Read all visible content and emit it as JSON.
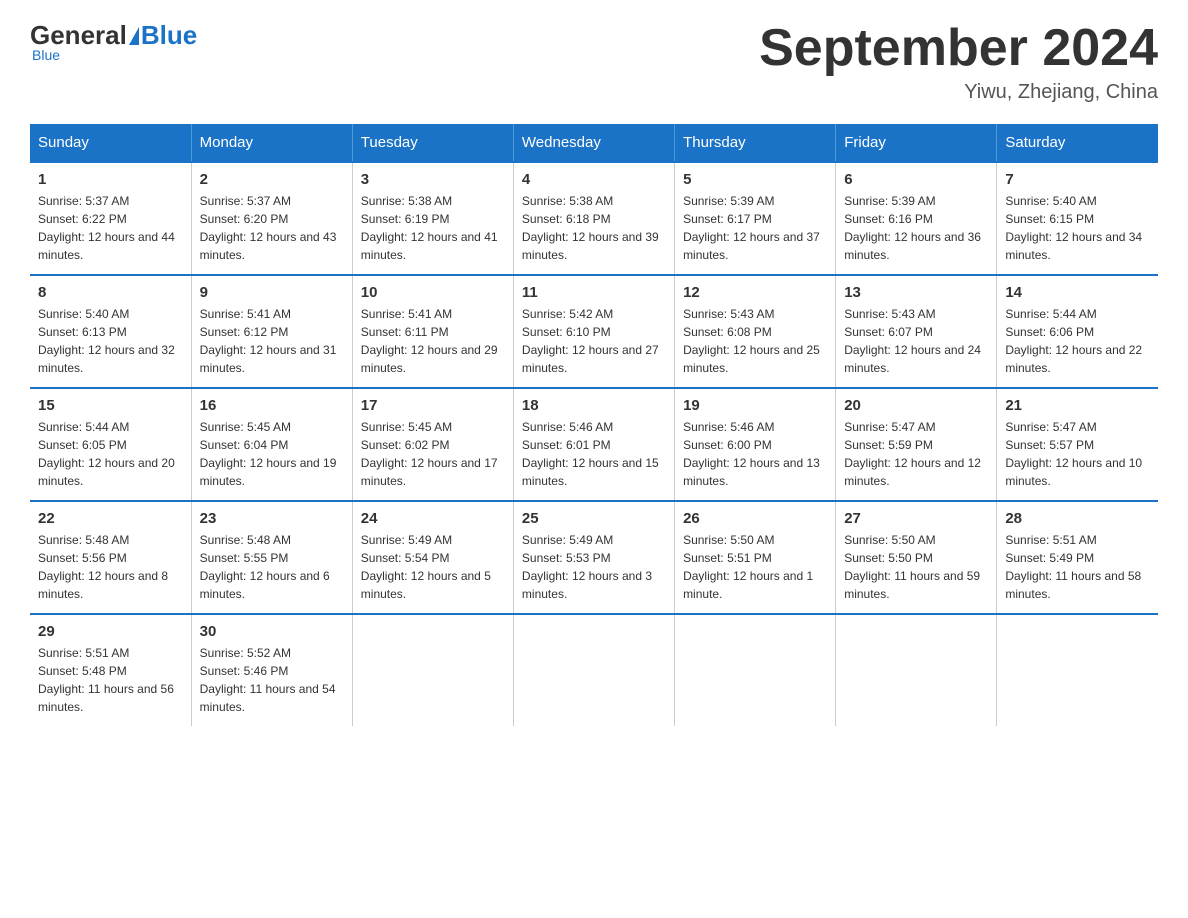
{
  "logo": {
    "general": "General",
    "blue": "Blue",
    "sub": "Blue"
  },
  "header": {
    "month_title": "September 2024",
    "subtitle": "Yiwu, Zhejiang, China"
  },
  "weekdays": [
    "Sunday",
    "Monday",
    "Tuesday",
    "Wednesday",
    "Thursday",
    "Friday",
    "Saturday"
  ],
  "weeks": [
    [
      {
        "day": "1",
        "sunrise": "5:37 AM",
        "sunset": "6:22 PM",
        "daylight": "12 hours and 44 minutes."
      },
      {
        "day": "2",
        "sunrise": "5:37 AM",
        "sunset": "6:20 PM",
        "daylight": "12 hours and 43 minutes."
      },
      {
        "day": "3",
        "sunrise": "5:38 AM",
        "sunset": "6:19 PM",
        "daylight": "12 hours and 41 minutes."
      },
      {
        "day": "4",
        "sunrise": "5:38 AM",
        "sunset": "6:18 PM",
        "daylight": "12 hours and 39 minutes."
      },
      {
        "day": "5",
        "sunrise": "5:39 AM",
        "sunset": "6:17 PM",
        "daylight": "12 hours and 37 minutes."
      },
      {
        "day": "6",
        "sunrise": "5:39 AM",
        "sunset": "6:16 PM",
        "daylight": "12 hours and 36 minutes."
      },
      {
        "day": "7",
        "sunrise": "5:40 AM",
        "sunset": "6:15 PM",
        "daylight": "12 hours and 34 minutes."
      }
    ],
    [
      {
        "day": "8",
        "sunrise": "5:40 AM",
        "sunset": "6:13 PM",
        "daylight": "12 hours and 32 minutes."
      },
      {
        "day": "9",
        "sunrise": "5:41 AM",
        "sunset": "6:12 PM",
        "daylight": "12 hours and 31 minutes."
      },
      {
        "day": "10",
        "sunrise": "5:41 AM",
        "sunset": "6:11 PM",
        "daylight": "12 hours and 29 minutes."
      },
      {
        "day": "11",
        "sunrise": "5:42 AM",
        "sunset": "6:10 PM",
        "daylight": "12 hours and 27 minutes."
      },
      {
        "day": "12",
        "sunrise": "5:43 AM",
        "sunset": "6:08 PM",
        "daylight": "12 hours and 25 minutes."
      },
      {
        "day": "13",
        "sunrise": "5:43 AM",
        "sunset": "6:07 PM",
        "daylight": "12 hours and 24 minutes."
      },
      {
        "day": "14",
        "sunrise": "5:44 AM",
        "sunset": "6:06 PM",
        "daylight": "12 hours and 22 minutes."
      }
    ],
    [
      {
        "day": "15",
        "sunrise": "5:44 AM",
        "sunset": "6:05 PM",
        "daylight": "12 hours and 20 minutes."
      },
      {
        "day": "16",
        "sunrise": "5:45 AM",
        "sunset": "6:04 PM",
        "daylight": "12 hours and 19 minutes."
      },
      {
        "day": "17",
        "sunrise": "5:45 AM",
        "sunset": "6:02 PM",
        "daylight": "12 hours and 17 minutes."
      },
      {
        "day": "18",
        "sunrise": "5:46 AM",
        "sunset": "6:01 PM",
        "daylight": "12 hours and 15 minutes."
      },
      {
        "day": "19",
        "sunrise": "5:46 AM",
        "sunset": "6:00 PM",
        "daylight": "12 hours and 13 minutes."
      },
      {
        "day": "20",
        "sunrise": "5:47 AM",
        "sunset": "5:59 PM",
        "daylight": "12 hours and 12 minutes."
      },
      {
        "day": "21",
        "sunrise": "5:47 AM",
        "sunset": "5:57 PM",
        "daylight": "12 hours and 10 minutes."
      }
    ],
    [
      {
        "day": "22",
        "sunrise": "5:48 AM",
        "sunset": "5:56 PM",
        "daylight": "12 hours and 8 minutes."
      },
      {
        "day": "23",
        "sunrise": "5:48 AM",
        "sunset": "5:55 PM",
        "daylight": "12 hours and 6 minutes."
      },
      {
        "day": "24",
        "sunrise": "5:49 AM",
        "sunset": "5:54 PM",
        "daylight": "12 hours and 5 minutes."
      },
      {
        "day": "25",
        "sunrise": "5:49 AM",
        "sunset": "5:53 PM",
        "daylight": "12 hours and 3 minutes."
      },
      {
        "day": "26",
        "sunrise": "5:50 AM",
        "sunset": "5:51 PM",
        "daylight": "12 hours and 1 minute."
      },
      {
        "day": "27",
        "sunrise": "5:50 AM",
        "sunset": "5:50 PM",
        "daylight": "11 hours and 59 minutes."
      },
      {
        "day": "28",
        "sunrise": "5:51 AM",
        "sunset": "5:49 PM",
        "daylight": "11 hours and 58 minutes."
      }
    ],
    [
      {
        "day": "29",
        "sunrise": "5:51 AM",
        "sunset": "5:48 PM",
        "daylight": "11 hours and 56 minutes."
      },
      {
        "day": "30",
        "sunrise": "5:52 AM",
        "sunset": "5:46 PM",
        "daylight": "11 hours and 54 minutes."
      },
      null,
      null,
      null,
      null,
      null
    ]
  ]
}
